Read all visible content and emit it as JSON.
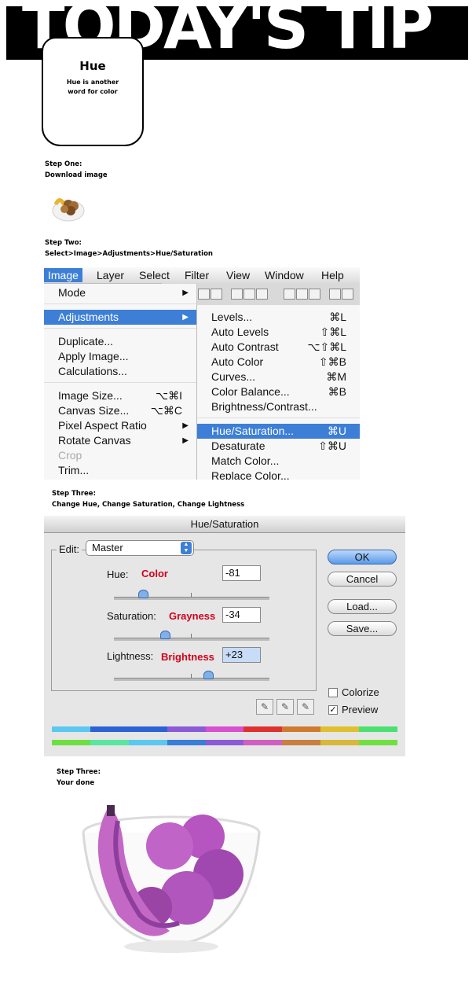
{
  "banner": {
    "title": "TODAY'S TIP"
  },
  "tip_card": {
    "title": "Hue",
    "description": "Hue is another word for color"
  },
  "step1": {
    "heading": "Step One:",
    "instruction": "Download image"
  },
  "step2": {
    "heading": "Step Two:",
    "instruction": "Select>Image>Adjustments>Hue/Saturation"
  },
  "menubar": {
    "items": [
      "Image",
      "Layer",
      "Select",
      "Filter",
      "View",
      "Window",
      "Help"
    ]
  },
  "image_menu": {
    "mode": "Mode",
    "adjustments": "Adjustments",
    "duplicate": "Duplicate...",
    "apply_image": "Apply Image...",
    "calculations": "Calculations...",
    "image_size": {
      "label": "Image Size...",
      "shortcut": "⌥⌘I"
    },
    "canvas_size": {
      "label": "Canvas Size...",
      "shortcut": "⌥⌘C"
    },
    "pixel_aspect": "Pixel Aspect Ratio",
    "rotate_canvas": "Rotate Canvas",
    "crop": "Crop",
    "trim": "Trim..."
  },
  "adjustments_menu": [
    {
      "label": "Levels...",
      "shortcut": "⌘L"
    },
    {
      "label": "Auto Levels",
      "shortcut": "⇧⌘L"
    },
    {
      "label": "Auto Contrast",
      "shortcut": "⌥⇧⌘L"
    },
    {
      "label": "Auto Color",
      "shortcut": "⇧⌘B"
    },
    {
      "label": "Curves...",
      "shortcut": "⌘M"
    },
    {
      "label": "Color Balance...",
      "shortcut": "⌘B"
    },
    {
      "label": "Brightness/Contrast...",
      "shortcut": ""
    },
    {
      "label": "Hue/Saturation...",
      "shortcut": "⌘U"
    },
    {
      "label": "Desaturate",
      "shortcut": "⇧⌘U"
    },
    {
      "label": "Match Color...",
      "shortcut": ""
    },
    {
      "label": "Replace Color...",
      "shortcut": ""
    }
  ],
  "step3": {
    "heading": "Step Three:",
    "instruction": "Change Hue, Change Saturation, Change Lightness"
  },
  "dialog": {
    "title": "Hue/Saturation",
    "edit_label": "Edit:",
    "edit_value": "Master",
    "hue": {
      "label": "Hue:",
      "tag": "Color",
      "value": "-81",
      "slider_fraction": 0.19
    },
    "saturation": {
      "label": "Saturation:",
      "tag": "Grayness",
      "value": "-34",
      "slider_fraction": 0.33
    },
    "lightness": {
      "label": "Lightness:",
      "tag": "Brightness",
      "value": "+23",
      "slider_fraction": 0.61
    },
    "buttons": {
      "ok": "OK",
      "cancel": "Cancel",
      "load": "Load...",
      "save": "Save..."
    },
    "colorize": {
      "label": "Colorize",
      "checked": false
    },
    "preview": {
      "label": "Preview",
      "checked": true,
      "mark": "✓"
    },
    "eyedropper_icons": [
      "eyedropper-icon",
      "eyedropper-plus-icon",
      "eyedropper-minus-icon"
    ],
    "top_bar_colors": [
      "#5bc8f0",
      "#2b62d6",
      "#2b62d6",
      "#8b5ad6",
      "#d84fd0",
      "#e03030",
      "#d07a30",
      "#e0c030",
      "#4ce070"
    ],
    "bottom_bar_colors": [
      "#6ce040",
      "#5ae6a0",
      "#5bc8f0",
      "#3a7ed8",
      "#8d5ad6",
      "#d060c0",
      "#c88040",
      "#d8b838",
      "#70e040"
    ]
  },
  "step4": {
    "heading": "Step Three:",
    "instruction": "Your done"
  }
}
